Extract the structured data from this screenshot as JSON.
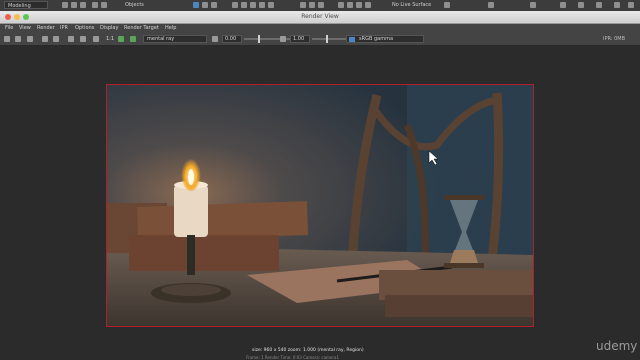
{
  "toolbar": {
    "mode_value": "Modeling",
    "objects_label": "Objects",
    "live_surface_label": "No Live Surface"
  },
  "window": {
    "title": "Render View",
    "close_color": "#ec5f57",
    "minimize_color": "#f5bd4f",
    "maximize_color": "#5fc655"
  },
  "menu": {
    "items": [
      "File",
      "View",
      "Render",
      "IPR",
      "Options",
      "Display",
      "Render Target",
      "Help"
    ]
  },
  "render_toolbar": {
    "one_to_one_label": "1:1",
    "renderer_value": "mental ray",
    "exposure_value": "0.00",
    "gamma_value": "1.00",
    "colorspace_value": "sRGB gamma",
    "ipr_label": "IPR: 0MB"
  },
  "status": {
    "line1": "size: 960 x 540  zoom: 1.000          (mental ray, Region)",
    "line2": "Frame: 1    Render Time: 0:03    Camera: camera1"
  },
  "watermark": "udemy",
  "colors": {
    "frame_border": "#b0202a",
    "accent_blue": "#4d86c0"
  }
}
